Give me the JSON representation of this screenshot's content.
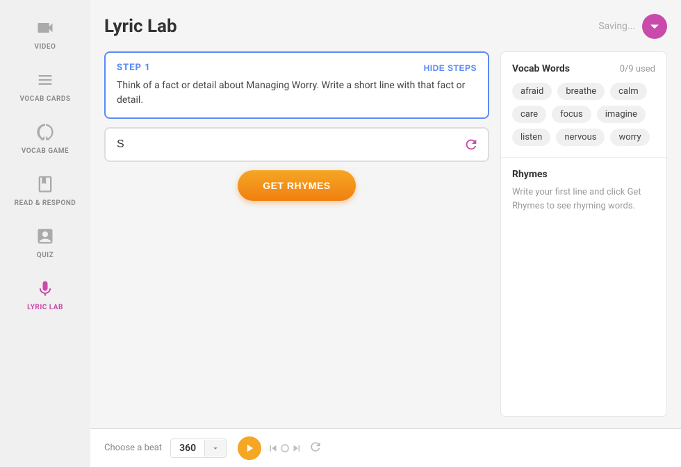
{
  "sidebar": {
    "items": [
      {
        "id": "video",
        "label": "VIDEO",
        "icon": "video"
      },
      {
        "id": "vocab-cards",
        "label": "VOCAB CARDS",
        "icon": "cards"
      },
      {
        "id": "vocab-game",
        "label": "VOCAB GAME",
        "icon": "game"
      },
      {
        "id": "read-respond",
        "label": "READ & RESPOND",
        "icon": "book"
      },
      {
        "id": "quiz",
        "label": "QUIZ",
        "icon": "quiz"
      },
      {
        "id": "lyric-lab",
        "label": "LYRIC LAB",
        "icon": "mic",
        "active": true
      }
    ]
  },
  "header": {
    "title": "Lyric Lab",
    "saving_text": "Saving..."
  },
  "step": {
    "label": "STEP 1",
    "hide_steps_label": "HIDE STEPS",
    "description": "Think of a fact or detail about Managing Worry. Write a short line with that fact or detail."
  },
  "input": {
    "value": "S",
    "placeholder": ""
  },
  "get_rhymes_button": "GET RHYMES",
  "vocab": {
    "title": "Vocab Words",
    "used": "0/9 used",
    "words": [
      "afraid",
      "breathe",
      "calm",
      "care",
      "focus",
      "imagine",
      "listen",
      "nervous",
      "worry"
    ]
  },
  "rhymes": {
    "title": "Rhymes",
    "hint": "Write your first line and click Get Rhymes to see rhyming words."
  },
  "beat": {
    "label": "Choose a beat",
    "value": "360"
  },
  "transport": {
    "play_label": "Play",
    "skip_back_label": "Skip back",
    "skip_forward_label": "Skip forward",
    "refresh_label": "Refresh"
  }
}
